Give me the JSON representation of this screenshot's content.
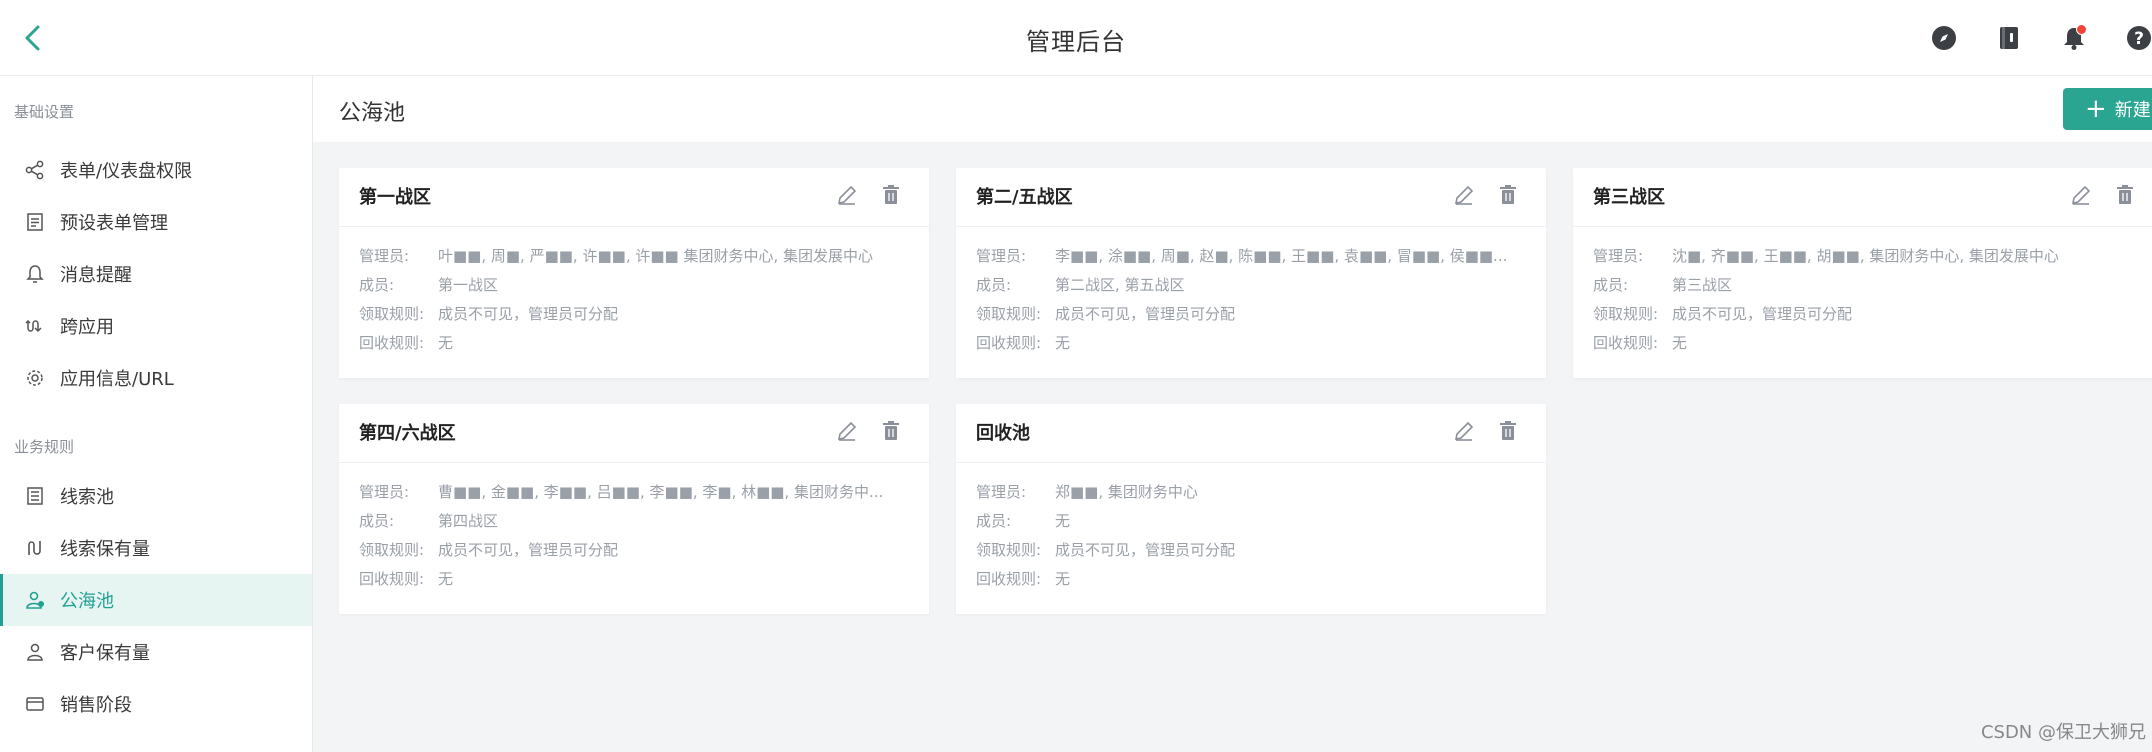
{
  "header": {
    "title": "管理后台",
    "icons": [
      "compass-icon",
      "book-icon",
      "bell-icon",
      "help-icon"
    ]
  },
  "sidebar": {
    "groups": [
      {
        "title": "基础设置",
        "items": [
          {
            "label": "表单/仪表盘权限",
            "icon": "share-icon"
          },
          {
            "label": "预设表单管理",
            "icon": "form-icon"
          },
          {
            "label": "消息提醒",
            "icon": "bell-outline-icon"
          },
          {
            "label": "跨应用",
            "icon": "switch-icon"
          },
          {
            "label": "应用信息/URL",
            "icon": "gear-icon"
          }
        ]
      },
      {
        "title": "业务规则",
        "items": [
          {
            "label": "线索池",
            "icon": "pool-icon"
          },
          {
            "label": "线索保有量",
            "icon": "retain-icon"
          },
          {
            "label": "公海池",
            "icon": "users-icon",
            "active": true
          },
          {
            "label": "客户保有量",
            "icon": "user-icon"
          },
          {
            "label": "销售阶段",
            "icon": "stage-icon"
          }
        ]
      }
    ]
  },
  "main": {
    "title": "公海池",
    "new_button": "新建",
    "labels": {
      "admin": "管理员:",
      "member": "成员:",
      "claim_rule": "领取规则:",
      "recycle_rule": "回收规则:"
    },
    "cards": [
      {
        "title": "第一战区",
        "admin": "叶■■, 周■, 严■■, 许■■, 许■■ 集团财务中心, 集团发展中心",
        "member": "第一战区",
        "claim_rule": "成员不可见，管理员可分配",
        "recycle_rule": "无"
      },
      {
        "title": "第二/五战区",
        "admin": "李■■, 涂■■, 周■, 赵■, 陈■■, 王■■, 袁■■, 冒■■, 侯■■...",
        "member": "第二战区, 第五战区",
        "claim_rule": "成员不可见，管理员可分配",
        "recycle_rule": "无"
      },
      {
        "title": "第三战区",
        "admin": "沈■, 齐■■, 王■■, 胡■■, 集团财务中心, 集团发展中心",
        "member": "第三战区",
        "claim_rule": "成员不可见，管理员可分配",
        "recycle_rule": "无"
      },
      {
        "title": "第四/六战区",
        "admin": "曹■■, 金■■, 李■■, 吕■■, 李■■, 李■, 林■■, 集团财务中...",
        "member": "第四战区",
        "claim_rule": "成员不可见，管理员可分配",
        "recycle_rule": "无"
      },
      {
        "title": "回收池",
        "admin": "郑■■, 集团财务中心",
        "member": "无",
        "claim_rule": "成员不可见，管理员可分配",
        "recycle_rule": "无"
      }
    ]
  },
  "watermark": "CSDN @保卫大狮兄",
  "colors": {
    "accent": "#2aa592",
    "active_bg": "#e6f4f2",
    "notification": "#f0443a"
  }
}
